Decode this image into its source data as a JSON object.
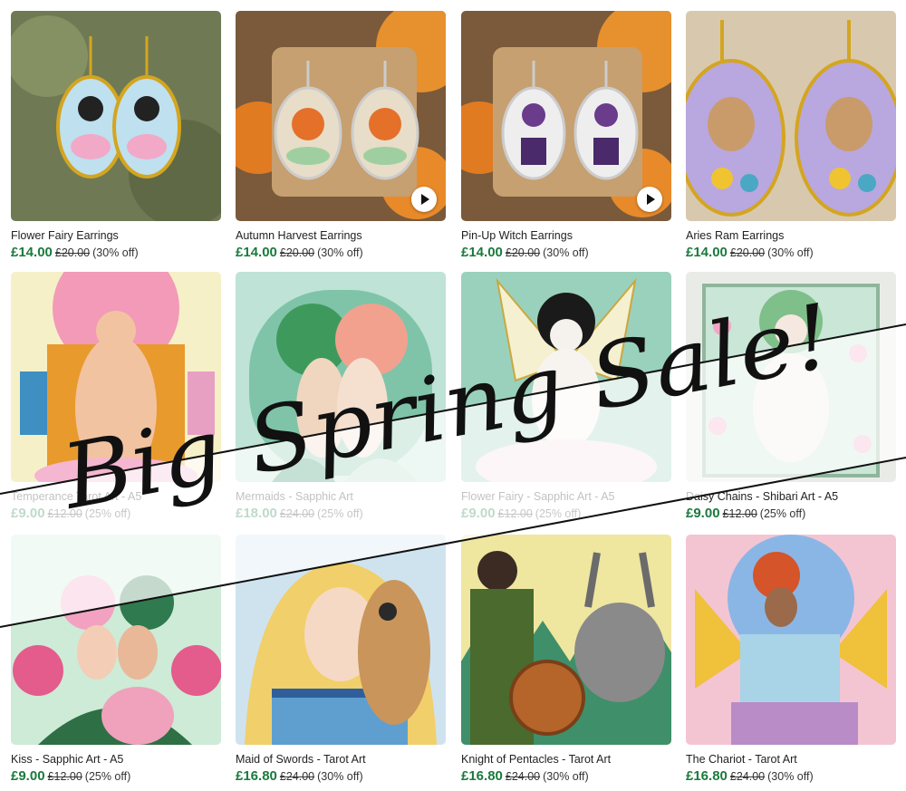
{
  "colors": {
    "price": "#1a7a3c",
    "banner_text": "#111111"
  },
  "banner": {
    "text": "Big Spring Sale!"
  },
  "products": [
    {
      "title": "Flower Fairy Earrings",
      "price": "£14.00",
      "original": "£20.00",
      "discount": "(30% off)",
      "video": false
    },
    {
      "title": "Autumn Harvest Earrings",
      "price": "£14.00",
      "original": "£20.00",
      "discount": "(30% off)",
      "video": true
    },
    {
      "title": "Pin-Up Witch Earrings",
      "price": "£14.00",
      "original": "£20.00",
      "discount": "(30% off)",
      "video": true
    },
    {
      "title": "Aries Ram Earrings",
      "price": "£14.00",
      "original": "£20.00",
      "discount": "(30% off)",
      "video": false
    },
    {
      "title": "Temperance Tarot Art - A5",
      "price": "£9.00",
      "original": "£12.00",
      "discount": "(25% off)",
      "video": false
    },
    {
      "title": "Mermaids - Sapphic Art",
      "price": "£18.00",
      "original": "£24.00",
      "discount": "(25% off)",
      "video": false
    },
    {
      "title": "Flower Fairy - Sapphic Art - A5",
      "price": "£9.00",
      "original": "£12.00",
      "discount": "(25% off)",
      "video": false
    },
    {
      "title": "Daisy Chains - Shibari Art - A5",
      "price": "£9.00",
      "original": "£12.00",
      "discount": "(25% off)",
      "video": false
    },
    {
      "title": "Kiss - Sapphic Art - A5",
      "price": "£9.00",
      "original": "£12.00",
      "discount": "(25% off)",
      "video": false
    },
    {
      "title": "Maid of Swords - Tarot Art",
      "price": "£16.80",
      "original": "£24.00",
      "discount": "(30% off)",
      "video": false
    },
    {
      "title": "Knight of Pentacles - Tarot Art",
      "price": "£16.80",
      "original": "£24.00",
      "discount": "(30% off)",
      "video": false
    },
    {
      "title": "The Chariot - Tarot Art",
      "price": "£16.80",
      "original": "£24.00",
      "discount": "(30% off)",
      "video": false
    }
  ]
}
